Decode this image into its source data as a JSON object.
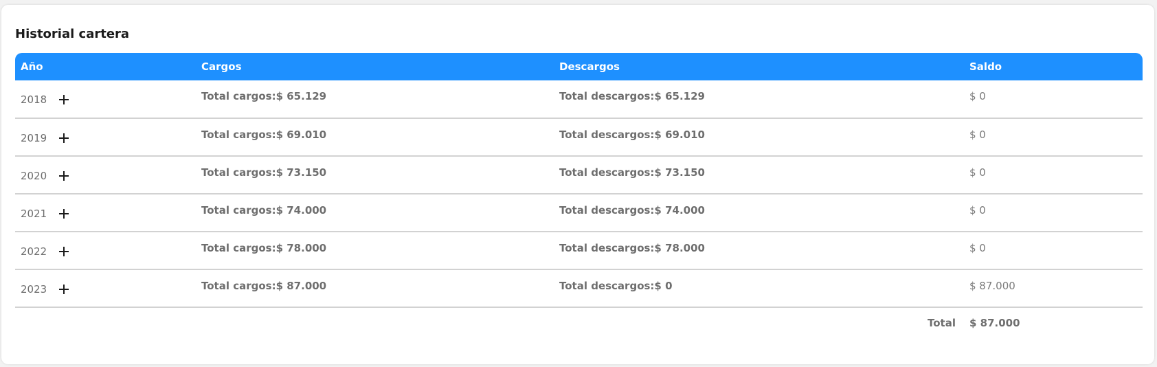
{
  "title": "Historial cartera",
  "header": {
    "year": "Año",
    "cargos": "Cargos",
    "descargos": "Descargos",
    "saldo": "Saldo"
  },
  "rows": [
    {
      "year": "2018",
      "cargos": "Total cargos:$ 65.129",
      "descargos": "Total descargos:$ 65.129",
      "saldo": "$ 0"
    },
    {
      "year": "2019",
      "cargos": "Total cargos:$ 69.010",
      "descargos": "Total descargos:$ 69.010",
      "saldo": "$ 0"
    },
    {
      "year": "2020",
      "cargos": "Total cargos:$ 73.150",
      "descargos": "Total descargos:$ 73.150",
      "saldo": "$ 0"
    },
    {
      "year": "2021",
      "cargos": "Total cargos:$ 74.000",
      "descargos": "Total descargos:$ 74.000",
      "saldo": "$ 0"
    },
    {
      "year": "2022",
      "cargos": "Total cargos:$ 78.000",
      "descargos": "Total descargos:$ 78.000",
      "saldo": "$ 0"
    },
    {
      "year": "2023",
      "cargos": "Total cargos:$ 87.000",
      "descargos": "Total descargos:$ 0",
      "saldo": "$ 87.000"
    }
  ],
  "total": {
    "label": "Total",
    "value": "$ 87.000"
  },
  "colors": {
    "header_bg": "#1e90ff",
    "header_text": "#ffffff",
    "row_text": "#6e6e6e",
    "divider": "#d2d2d2"
  },
  "icons": {
    "expand": "plus-icon"
  }
}
